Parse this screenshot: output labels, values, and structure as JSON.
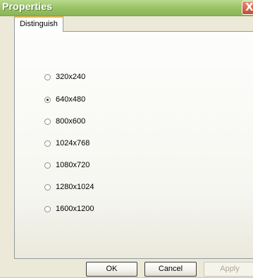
{
  "window": {
    "title": "Properties",
    "close_label": "X"
  },
  "tabs": [
    {
      "label": "Distinguish",
      "selected": true
    }
  ],
  "resolutions": {
    "options": [
      {
        "label": "320x240",
        "selected": false
      },
      {
        "label": "640x480",
        "selected": true
      },
      {
        "label": "800x600",
        "selected": false
      },
      {
        "label": "1024x768",
        "selected": false
      },
      {
        "label": "1080x720",
        "selected": false
      },
      {
        "label": "1280x1024",
        "selected": false
      },
      {
        "label": "1600x1200",
        "selected": false
      }
    ]
  },
  "buttons": {
    "ok": "OK",
    "cancel": "Cancel",
    "apply": "Apply",
    "apply_enabled": false
  }
}
